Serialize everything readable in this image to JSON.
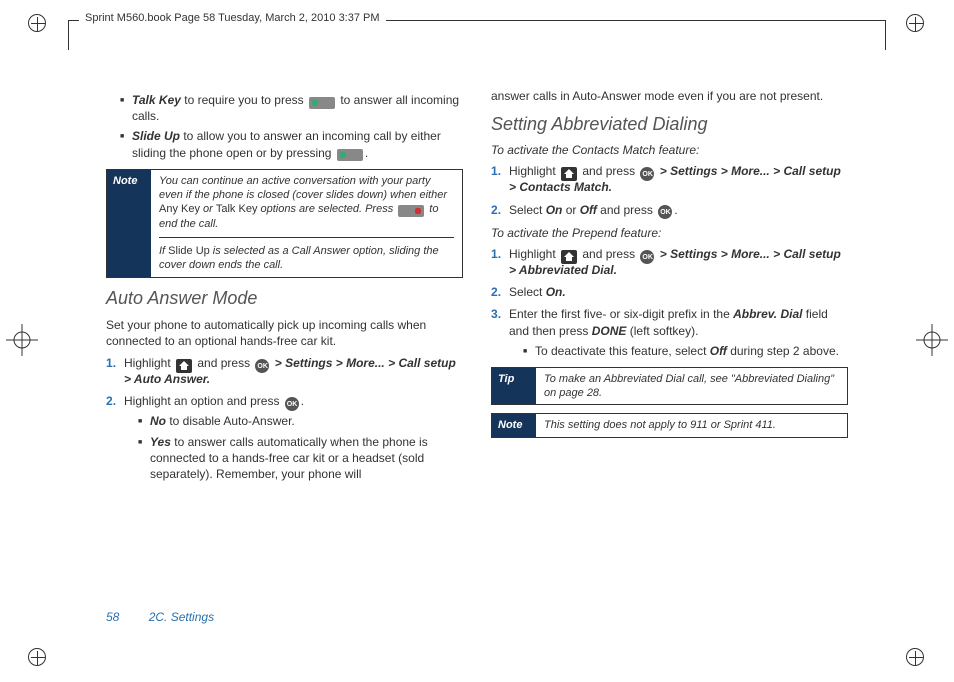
{
  "meta": {
    "header_line": "Sprint M560.book  Page 58  Tuesday, March 2, 2010  3:37 PM"
  },
  "left": {
    "talk_key_label": "Talk Key",
    "talk_key_text_before": " to require you to press ",
    "talk_key_text_after": " to answer all incoming calls.",
    "slide_up_label": "Slide Up",
    "slide_up_text_before": " to allow you to answer an incoming call by either sliding the phone open or by pressing ",
    "slide_up_text_after": ".",
    "note_label": "Note",
    "note_part1_before": "You can continue an active conversation with your party even if the phone is closed (cover slides down) when either ",
    "note_anykey": "Any Key",
    "note_or": " or ",
    "note_talkkey": "Talk Key",
    "note_part1_mid": " options are selected. Press ",
    "note_part1_after": " to end the call.",
    "note_part2_before": "If ",
    "note_slideup": "Slide Up",
    "note_part2_after": " is selected as a Call Answer option, sliding the cover down ends the call.",
    "section_auto": "Auto Answer Mode",
    "auto_intro": "Set your phone to automatically pick up incoming calls when connected to an optional hands-free car kit.",
    "step1_before": "Highlight ",
    "step1_mid": " and press ",
    "step1_path": " > Settings > More... > Call setup > Auto Answer.",
    "step2_before": "Highlight an option and press ",
    "step2_after": ".",
    "no_label": "No",
    "no_text": " to disable Auto-Answer.",
    "yes_label": "Yes",
    "yes_text": " to answer calls automatically when the phone is connected to a hands-free car kit or a headset (sold separately). Remember, your phone will"
  },
  "right": {
    "carry_over": "answer calls in Auto-Answer mode even if you are not present.",
    "section_abbrev": "Setting Abbreviated Dialing",
    "activate_contacts": "To activate the Contacts Match feature:",
    "cm_step1_before": "Highlight ",
    "cm_step1_mid": " and press ",
    "cm_step1_path": " > Settings > More... > Call setup > Contacts Match.",
    "cm_step2_before": "Select ",
    "cm_on": "On",
    "cm_or": " or ",
    "cm_off": "Off",
    "cm_step2_mid": " and press ",
    "cm_step2_after": ".",
    "activate_prepend": "To activate the Prepend feature:",
    "pp_step1_before": "Highlight ",
    "pp_step1_mid": " and press ",
    "pp_step1_path": " > Settings > More... > Call setup > Abbreviated Dial.",
    "pp_step2_before": "Select ",
    "pp_step2_on": "On.",
    "pp_step3_before": "Enter the first five- or six-digit prefix in the ",
    "pp_step3_field": "Abbrev. Dial",
    "pp_step3_mid": " field and then press ",
    "pp_step3_done": "DONE",
    "pp_step3_after": " (left softkey).",
    "pp_deact_before": "To deactivate this feature, select ",
    "pp_deact_off": "Off",
    "pp_deact_after": " during step 2 above.",
    "tip_label": "Tip",
    "tip_text": "To make an Abbreviated Dial call, see \"Abbreviated Dialing\" on page 28.",
    "note2_label": "Note",
    "note2_text": "This setting does not apply to 911 or Sprint 411."
  },
  "footer": {
    "page_number": "58",
    "section_ref": "2C. Settings"
  }
}
